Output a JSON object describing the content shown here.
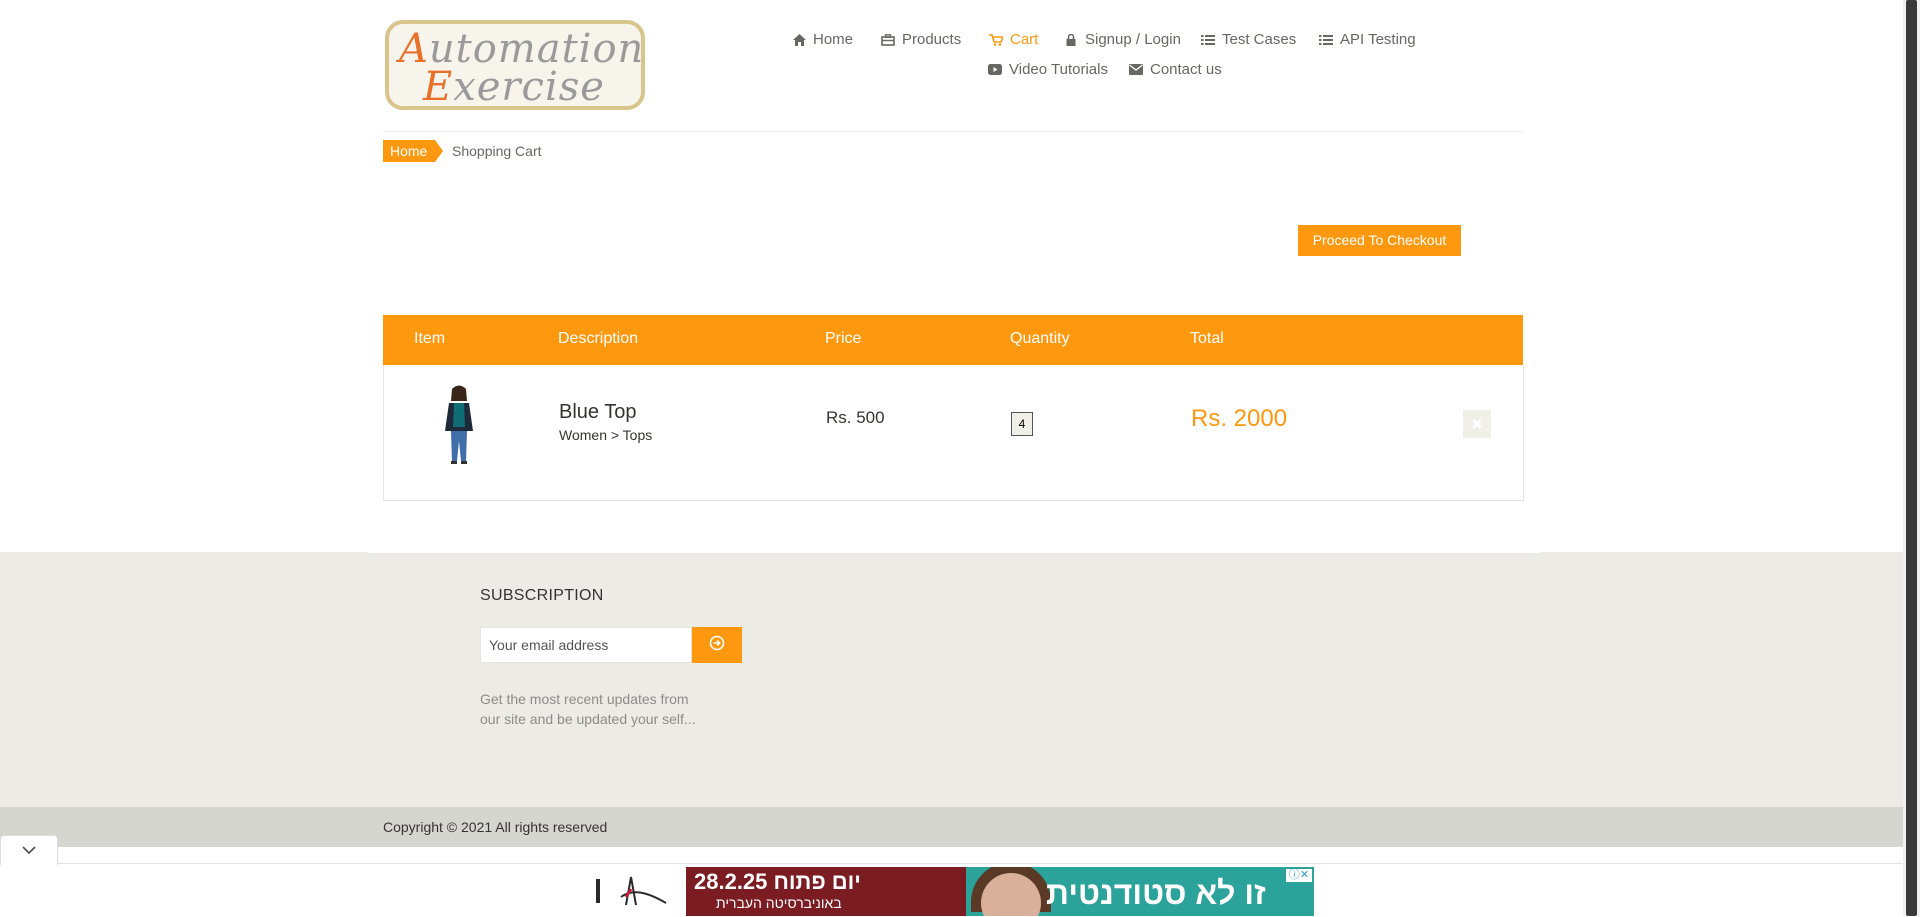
{
  "logo": {
    "line1_cap": "A",
    "line1_rest": "utomation",
    "line2_cap": "E",
    "line2_rest": "xercise"
  },
  "nav": [
    {
      "label": "Home",
      "icon": "home-icon"
    },
    {
      "label": "Products",
      "icon": "products-icon"
    },
    {
      "label": "Cart",
      "icon": "cart-icon",
      "active": true
    },
    {
      "label": "Signup / Login",
      "icon": "lock-icon"
    },
    {
      "label": "Test Cases",
      "icon": "list-icon"
    },
    {
      "label": "API Testing",
      "icon": "list-icon"
    },
    {
      "label": "Video Tutorials",
      "icon": "youtube-icon"
    },
    {
      "label": "Contact us",
      "icon": "envelope-icon"
    }
  ],
  "breadcrumb": {
    "home": "Home",
    "current": "Shopping Cart"
  },
  "checkout": {
    "label": "Proceed To Checkout"
  },
  "cart": {
    "headers": {
      "item": "Item",
      "description": "Description",
      "price": "Price",
      "quantity": "Quantity",
      "total": "Total"
    },
    "rows": [
      {
        "name": "Blue Top",
        "category": "Women > Tops",
        "price": "Rs. 500",
        "quantity": "4",
        "total": "Rs. 2000",
        "delete_icon": "close-icon"
      }
    ]
  },
  "subscription": {
    "title": "SUBSCRIPTION",
    "placeholder": "Your email address",
    "text_line1": "Get the most recent updates from",
    "text_line2": "our site and be updated your self..."
  },
  "footer": {
    "copyright": "Copyright © 2021 All rights reserved"
  },
  "ad": {
    "date_text": "28.2.25 יום פתוח",
    "university_text": "באוניברסיטה העברית",
    "headline": "זו לא סטודנטית"
  },
  "colors": {
    "accent": "#fe980f",
    "footer_bg": "#ecebe5",
    "ad_red": "#7b1b22",
    "ad_teal": "#2ba39b"
  }
}
